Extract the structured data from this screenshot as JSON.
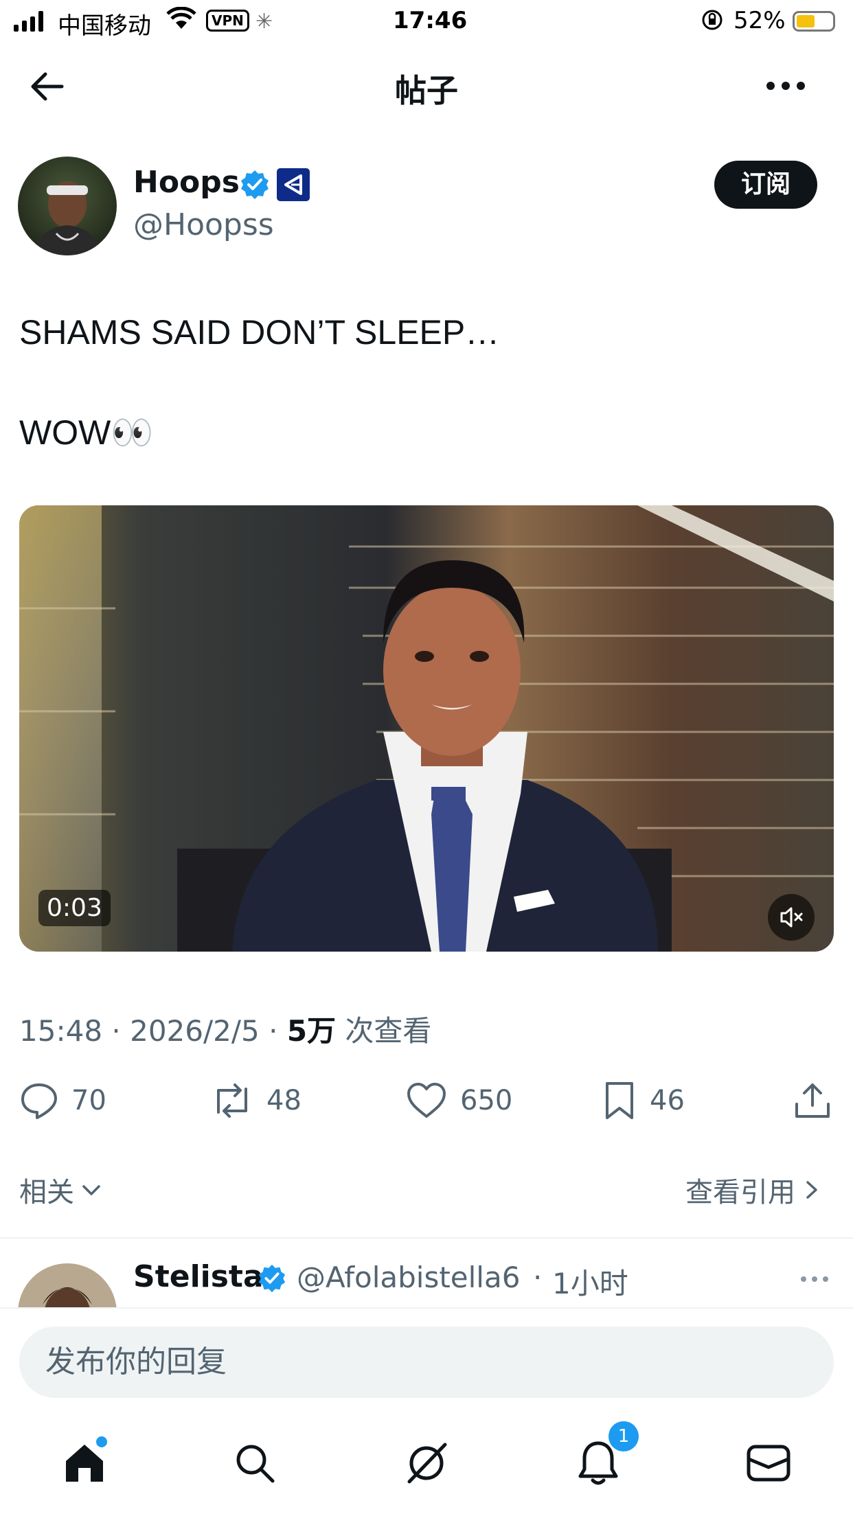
{
  "status_bar": {
    "carrier": "中国移动",
    "vpn": "VPN",
    "time": "17:46",
    "battery": "52%",
    "battery_level": 0.52
  },
  "header": {
    "title": "帖子"
  },
  "post": {
    "author_name": "Hoops",
    "author_handle": "@Hoopss",
    "subscribe_label": "订阅",
    "text_line1": "SHAMS SAID DON’T SLEEP…",
    "text_line2": "WOW👀",
    "video_duration": "0:03",
    "time": "15:48",
    "date": "2026/2/5",
    "views_count": "5万",
    "views_label": "次查看",
    "replies": "70",
    "reposts": "48",
    "likes": "650",
    "bookmarks": "46"
  },
  "related": {
    "label": "相关",
    "quotes_label": "查看引用"
  },
  "reply_preview": {
    "name": "Stelista",
    "handle": "@Afolabistella6",
    "time": "1小时"
  },
  "composer": {
    "placeholder": "发布你的回复"
  },
  "tabbar": {
    "notifications_badge": "1"
  },
  "colors": {
    "verified": "#1d9bf0",
    "text": "#0f1419",
    "secondary": "#536471"
  }
}
